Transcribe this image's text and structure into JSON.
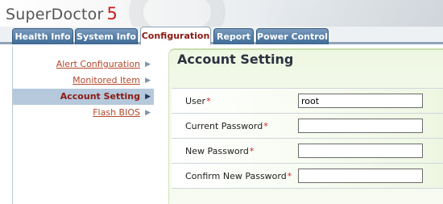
{
  "app": {
    "name": "SuperDoctor",
    "version": "5"
  },
  "tabs": [
    {
      "label": "Health Info",
      "active": false
    },
    {
      "label": "System Info",
      "active": false
    },
    {
      "label": "Configuration",
      "active": true
    },
    {
      "label": "Report",
      "active": false
    },
    {
      "label": "Power Control",
      "active": false
    }
  ],
  "nav": {
    "items": [
      {
        "label": "Alert Configuration",
        "active": false
      },
      {
        "label": "Monitored Item",
        "active": false
      },
      {
        "label": "Account Setting",
        "active": true
      },
      {
        "label": "Flash BIOS",
        "active": false
      }
    ]
  },
  "panel": {
    "title": "Account Setting",
    "fields": {
      "user": {
        "label": "User",
        "required_mark": "*",
        "value": "root"
      },
      "current_password": {
        "label": "Current Password",
        "required_mark": "*",
        "value": ""
      },
      "new_password": {
        "label": "New Password",
        "required_mark": "*",
        "value": ""
      },
      "confirm_password": {
        "label": "Confirm New Password",
        "required_mark": "*",
        "value": ""
      }
    }
  },
  "colors": {
    "tab_active_text": "#8b1a12",
    "link": "#b5472a",
    "required": "#d1201a",
    "logo_version": "#c8201c"
  }
}
